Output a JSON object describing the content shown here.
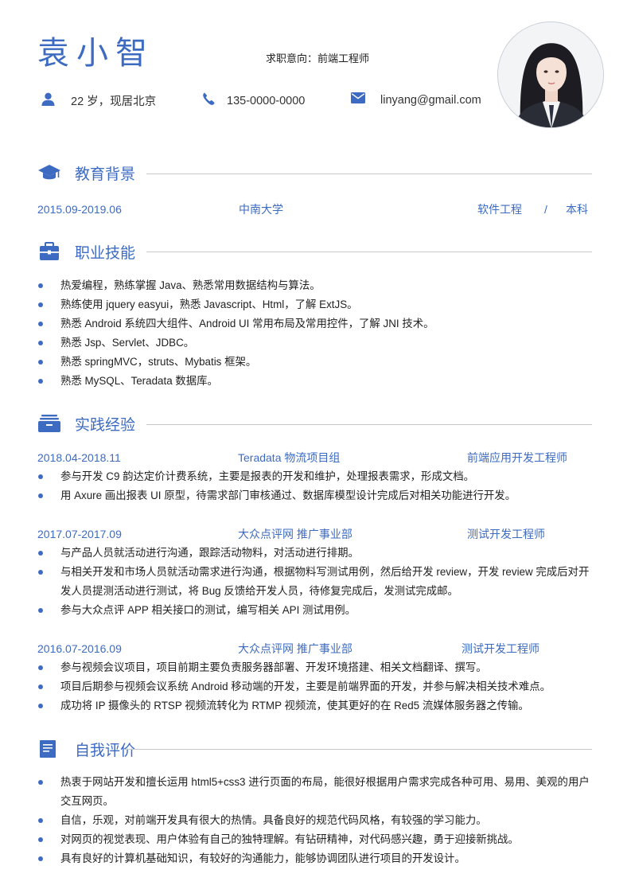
{
  "header": {
    "name": "袁小智",
    "intent": "求职意向：前端工程师",
    "age_location": "22 岁，现居北京",
    "phone": "135-0000-0000",
    "email": "linyang@gmail.com",
    "icons": [
      "user-icon",
      "phone-icon",
      "mail-icon"
    ],
    "accent": "#3d6bc2"
  },
  "education": {
    "title": "教育背景",
    "date": "2015.09-2019.06",
    "school": "中南大学",
    "major": "软件工程",
    "sep": "/",
    "degree": "本科"
  },
  "skills": {
    "title": "职业技能",
    "items": [
      "热爱编程，熟练掌握 Java、熟悉常用数据结构与算法。",
      "熟练使用 jquery easyui，熟悉 Javascript、Html，了解 ExtJS。",
      "熟悉 Android 系统四大组件、Android UI 常用布局及常用控件，了解 JNI 技术。",
      "熟悉 Jsp、Servlet、JDBC。",
      "熟悉 springMVC，struts、Mybatis 框架。",
      "熟悉 MySQL、Teradata 数据库。"
    ]
  },
  "experience": {
    "title": "实践经验",
    "jobs": [
      {
        "date": "2018.04-2018.11",
        "org": "Teradata  物流项目组",
        "role": "前端应用开发工程师",
        "items": [
          "参与开发 C9 韵达定价计费系统，主要是报表的开发和维护，处理报表需求，形成文档。",
          "用 Axure 画出报表 UI 原型，待需求部门审核通过、数据库模型设计完成后对相关功能进行开发。"
        ]
      },
      {
        "date": "2017.07-2017.09",
        "org": "大众点评网   推广事业部",
        "role": "测试开发工程师",
        "items": [
          "与产品人员就活动进行沟通，跟踪活动物料，对活动进行排期。",
          "与相关开发和市场人员就活动需求进行沟通，根据物料写测试用例，然后给开发 review，开发 review 完成后对开发人员提测活动进行测试，将 Bug 反馈给开发人员，待修复完成后，发测试完成邮。",
          "参与大众点评 APP 相关接口的测试，编写相关 API 测试用例。"
        ]
      },
      {
        "date": "2016.07-2016.09",
        "org": "大众点评网   推广事业部",
        "role": "测试开发工程师",
        "items": [
          "参与视频会议项目，项目前期主要负责服务器部署、开发环境搭建、相关文档翻译、撰写。",
          "项目后期参与视频会议系统 Android 移动端的开发，主要是前端界面的开发，并参与解决相关技术难点。",
          "成功将 IP 摄像头的 RTSP 视频流转化为 RTMP 视频流，使其更好的在 Red5 流媒体服务器之传输。"
        ]
      }
    ]
  },
  "self_eval": {
    "title": "自我评价",
    "items": [
      "热衷于网站开发和擅长运用 html5+css3 进行页面的布局，能很好根据用户需求完成各种可用、易用、美观的用户交互网页。",
      "自信，乐观，对前端开发具有很大的热情。具备良好的规范代码风格，有较强的学习能力。",
      "对网页的视觉表现、用户体验有自己的独特理解。有钻研精神，对代码感兴趣，勇于迎接新挑战。",
      "具有良好的计算机基础知识，有较好的沟通能力，能够协调团队进行项目的开发设计。"
    ]
  }
}
